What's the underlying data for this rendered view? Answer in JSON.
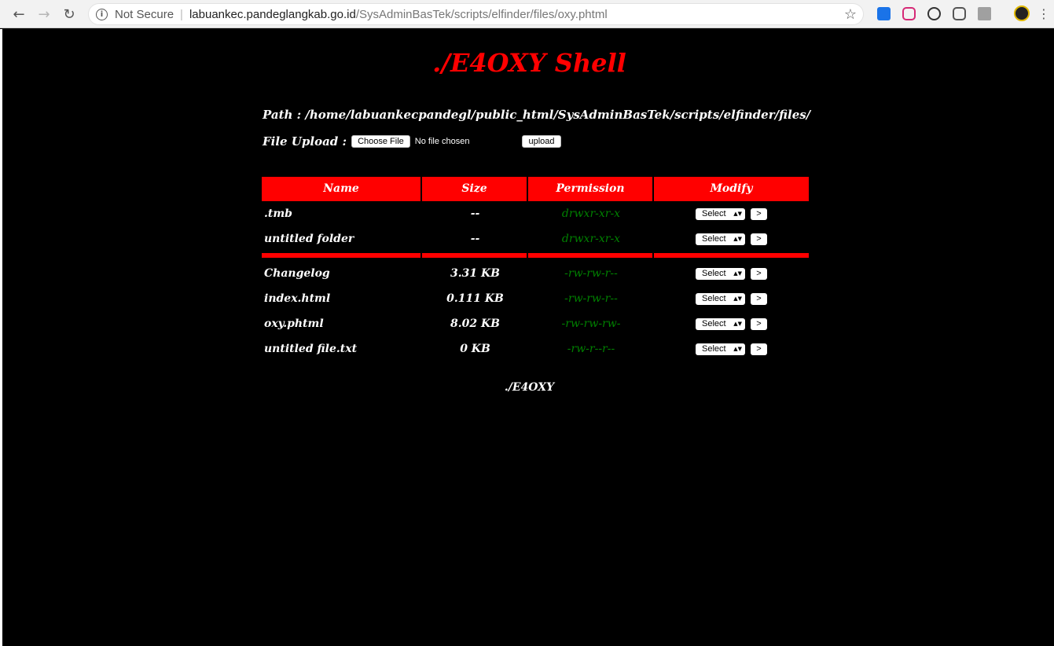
{
  "browser": {
    "not_secure_label": "Not Secure",
    "url_host": "labuankec.pandeglangkab.go.id",
    "url_path": "/SysAdminBasTek/scripts/elfinder/files/oxy.phtml"
  },
  "page": {
    "title": "./E4OXY Shell",
    "path_text": "Path : /home/labuankecpandegl/public_html/SysAdminBasTek/scripts/elfinder/files/",
    "upload_label": "File Upload :",
    "choose_file_label": "Choose File",
    "no_file_text": "No file chosen",
    "upload_button_label": "upload",
    "footer": "./E4OXY"
  },
  "table": {
    "headers": {
      "name": "Name",
      "size": "Size",
      "permission": "Permission",
      "modify": "Modify"
    },
    "folders": [
      {
        "name": ".tmb",
        "size": "--",
        "permission": "drwxr-xr-x",
        "select": "Select",
        "go": ">"
      },
      {
        "name": "untitled folder",
        "size": "--",
        "permission": "drwxr-xr-x",
        "select": "Select",
        "go": ">"
      }
    ],
    "files": [
      {
        "name": "Changelog",
        "size": "3.31 KB",
        "permission": "-rw-rw-r--",
        "select": "Select",
        "go": ">"
      },
      {
        "name": "index.html",
        "size": "0.111 KB",
        "permission": "-rw-rw-r--",
        "select": "Select",
        "go": ">"
      },
      {
        "name": "oxy.phtml",
        "size": "8.02 KB",
        "permission": "-rw-rw-rw-",
        "select": "Select",
        "go": ">"
      },
      {
        "name": "untitled file.txt",
        "size": "0 KB",
        "permission": "-rw-r--r--",
        "select": "Select",
        "go": ">"
      }
    ]
  },
  "colors": {
    "accent": "#ff0000",
    "permission": "#008000",
    "background": "#000000"
  }
}
